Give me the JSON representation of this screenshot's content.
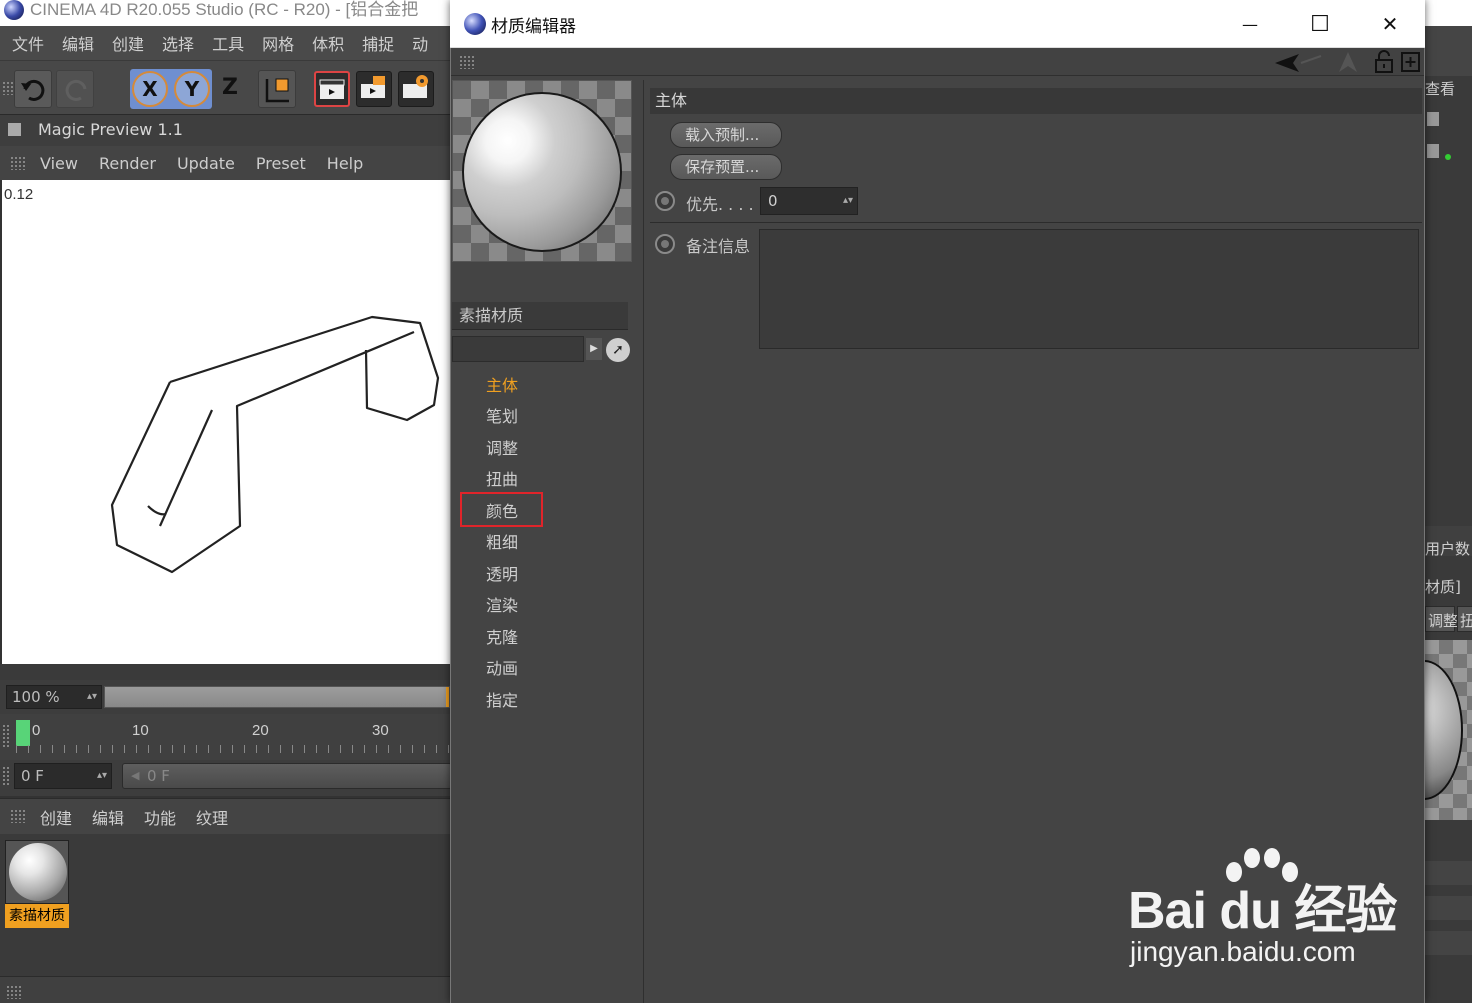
{
  "main_window": {
    "title": "CINEMA 4D R20.055 Studio (RC - R20) - [铝合金把",
    "menu": [
      "文件",
      "编辑",
      "创建",
      "选择",
      "工具",
      "网格",
      "体积",
      "捕捉",
      "动"
    ],
    "axis_buttons": [
      "X",
      "Y",
      "Z"
    ]
  },
  "magic_preview": {
    "title": "Magic Preview 1.1",
    "menu": [
      "View",
      "Render",
      "Update",
      "Preset",
      "Help"
    ],
    "value": "0.12",
    "zoom": "100 %"
  },
  "timeline": {
    "labels": [
      "0",
      "10",
      "20",
      "30"
    ],
    "current_frame": "0 F",
    "slider_frame": "0 F"
  },
  "material_manager": {
    "menu": [
      "创建",
      "编辑",
      "功能",
      "纹理"
    ],
    "material_name": "素描材质"
  },
  "right_panel": {
    "texts": [
      "查看",
      "用户数",
      "材质]",
      "调整",
      "扭"
    ]
  },
  "material_editor": {
    "title": "材质编辑器",
    "win_controls": [
      "—",
      "☐",
      "✕"
    ],
    "material_name": "素描材质",
    "channels": [
      {
        "label": "主体",
        "active": true
      },
      {
        "label": "笔划",
        "active": false
      },
      {
        "label": "调整",
        "active": false
      },
      {
        "label": "扭曲",
        "active": false
      },
      {
        "label": "颜色",
        "active": false
      },
      {
        "label": "粗细",
        "active": false
      },
      {
        "label": "透明",
        "active": false
      },
      {
        "label": "渲染",
        "active": false
      },
      {
        "label": "克隆",
        "active": false
      },
      {
        "label": "动画",
        "active": false
      },
      {
        "label": "指定",
        "active": false
      }
    ],
    "highlighted_channel": "颜色",
    "section_header": "主体",
    "load_preset": "载入预制...",
    "save_preset": "保存预置...",
    "priority_label": "优先. . . .",
    "priority_value": "0",
    "notes_label": "备注信息",
    "notes_value": ""
  },
  "watermark": {
    "logo": "Bai du 经验",
    "url": "jingyan.baidu.com"
  },
  "colors": {
    "accent": "#f0a020",
    "highlight": "#e0242a",
    "panel": "#444444"
  }
}
